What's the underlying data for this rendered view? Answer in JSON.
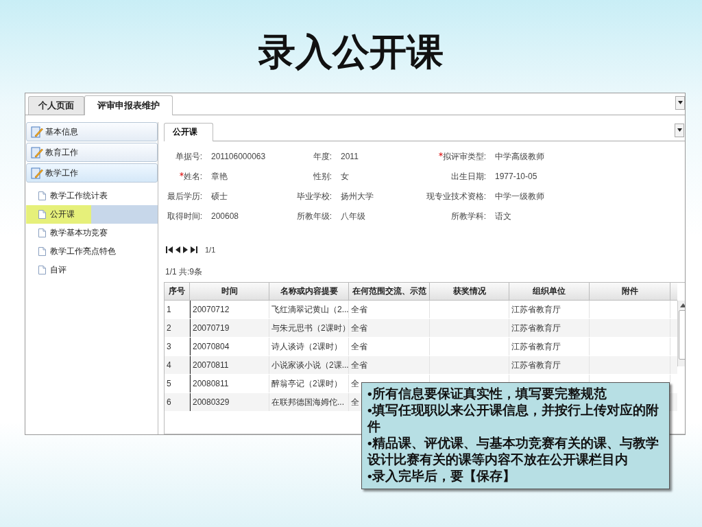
{
  "slide_title": "录入公开课",
  "window": {
    "tabs": [
      {
        "label": "个人页面",
        "selected": false
      },
      {
        "label": "评审申报表维护",
        "selected": true
      }
    ]
  },
  "sidebar": {
    "sections": [
      {
        "label": "基本信息",
        "expanded": false
      },
      {
        "label": "教育工作",
        "expanded": false
      },
      {
        "label": "教学工作",
        "expanded": true,
        "children": [
          {
            "label": "教学工作统计表",
            "selected": false
          },
          {
            "label": "公开课",
            "selected": true
          },
          {
            "label": "教学基本功竞赛",
            "selected": false
          },
          {
            "label": "教学工作亮点特色",
            "selected": false
          },
          {
            "label": "自评",
            "selected": false
          }
        ]
      }
    ]
  },
  "content_tabs": [
    {
      "label": "公开课",
      "selected": true
    }
  ],
  "form": [
    {
      "label": "单据号:",
      "value": "201106000063",
      "required": false
    },
    {
      "label": "年度:",
      "value": "2011",
      "required": false
    },
    {
      "label": "拟评审类型:",
      "value": "中学高级教师",
      "required": true
    },
    {
      "label": "姓名:",
      "value": "章艳",
      "required": true
    },
    {
      "label": "性别:",
      "value": "女",
      "required": false
    },
    {
      "label": "出生日期:",
      "value": "1977-10-05",
      "required": false
    },
    {
      "label": "最后学历:",
      "value": "硕士",
      "required": false
    },
    {
      "label": "毕业学校:",
      "value": "扬州大学",
      "required": false
    },
    {
      "label": "现专业技术资格:",
      "value": "中学一级教师",
      "required": false
    },
    {
      "label": "取得时间:",
      "value": "200608",
      "required": false
    },
    {
      "label": "所教年级:",
      "value": "八年级",
      "required": false
    },
    {
      "label": "所教学科:",
      "value": "语文",
      "required": false
    }
  ],
  "pager": {
    "page": "1/1",
    "summary": "1/1 共:9条"
  },
  "table": {
    "columns": [
      "序号",
      "时间",
      "名称或内容提要",
      "在何范围交流、示范",
      "获奖情况",
      "组织单位",
      "附件"
    ],
    "rows": [
      [
        "1",
        "20070712",
        "飞红滴翠记黄山（2...",
        "全省",
        "",
        "江苏省教育厅",
        ""
      ],
      [
        "2",
        "20070719",
        "与朱元思书（2课时）",
        "全省",
        "",
        "江苏省教育厅",
        ""
      ],
      [
        "3",
        "20070804",
        "诗人谈诗（2课时）",
        "全省",
        "",
        "江苏省教育厅",
        ""
      ],
      [
        "4",
        "20070811",
        "小说家谈小说（2课...",
        "全省",
        "",
        "江苏省教育厅",
        ""
      ],
      [
        "5",
        "20080811",
        "醉翁亭记（2课时）",
        "全",
        "",
        "",
        ""
      ],
      [
        "6",
        "20080329",
        "在联邦德国海姆佗...",
        "全",
        "",
        "",
        ""
      ]
    ]
  },
  "callout": [
    "•所有信息要保证真实性，填写要完整规范",
    "•填写任现职以来公开课信息，并按行上传对应的附件",
    "•精品课、评优课、与基本功竞赛有关的课、与教学设计比赛有关的课等内容不放在公开课栏目内",
    "•录入完毕后，要【保存】"
  ]
}
